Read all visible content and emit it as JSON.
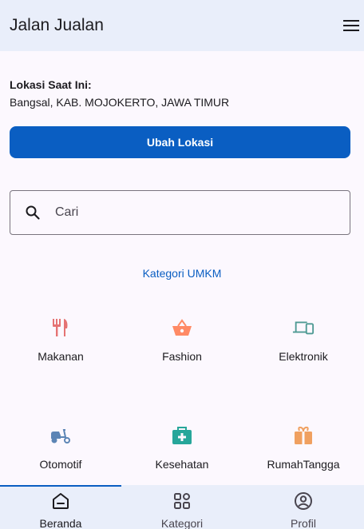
{
  "app": {
    "title": "Jalan Jualan"
  },
  "location": {
    "label": "Lokasi Saat Ini:",
    "value": "Bangsal, KAB. MOJOKERTO, JAWA TIMUR",
    "button_label": "Ubah Lokasi"
  },
  "search": {
    "placeholder": "Cari",
    "icon": "search-icon"
  },
  "categories": {
    "heading": "Kategori UMKM",
    "items": [
      {
        "label": "Makanan",
        "icon": "utensils-icon",
        "color": "#e57373"
      },
      {
        "label": "Fashion",
        "icon": "basket-icon",
        "color": "#ff8a65"
      },
      {
        "label": "Elektronik",
        "icon": "devices-icon",
        "color": "#4f9a94"
      },
      {
        "label": "Otomotif",
        "icon": "scooter-icon",
        "color": "#5c85b5"
      },
      {
        "label": "Kesehatan",
        "icon": "medical-bag-icon",
        "color": "#26a69a"
      },
      {
        "label": "RumahTangga",
        "icon": "home-gift-icon",
        "color": "#f0a060"
      }
    ]
  },
  "bottom_nav": {
    "items": [
      {
        "label": "Beranda",
        "icon": "home-icon",
        "active": true
      },
      {
        "label": "Kategori",
        "icon": "grid-icon",
        "active": false
      },
      {
        "label": "Profil",
        "icon": "profile-icon",
        "active": false
      }
    ]
  },
  "colors": {
    "accent": "#0a5ec2",
    "app_bar": "#e9eefa",
    "background": "#fcf8fe"
  }
}
